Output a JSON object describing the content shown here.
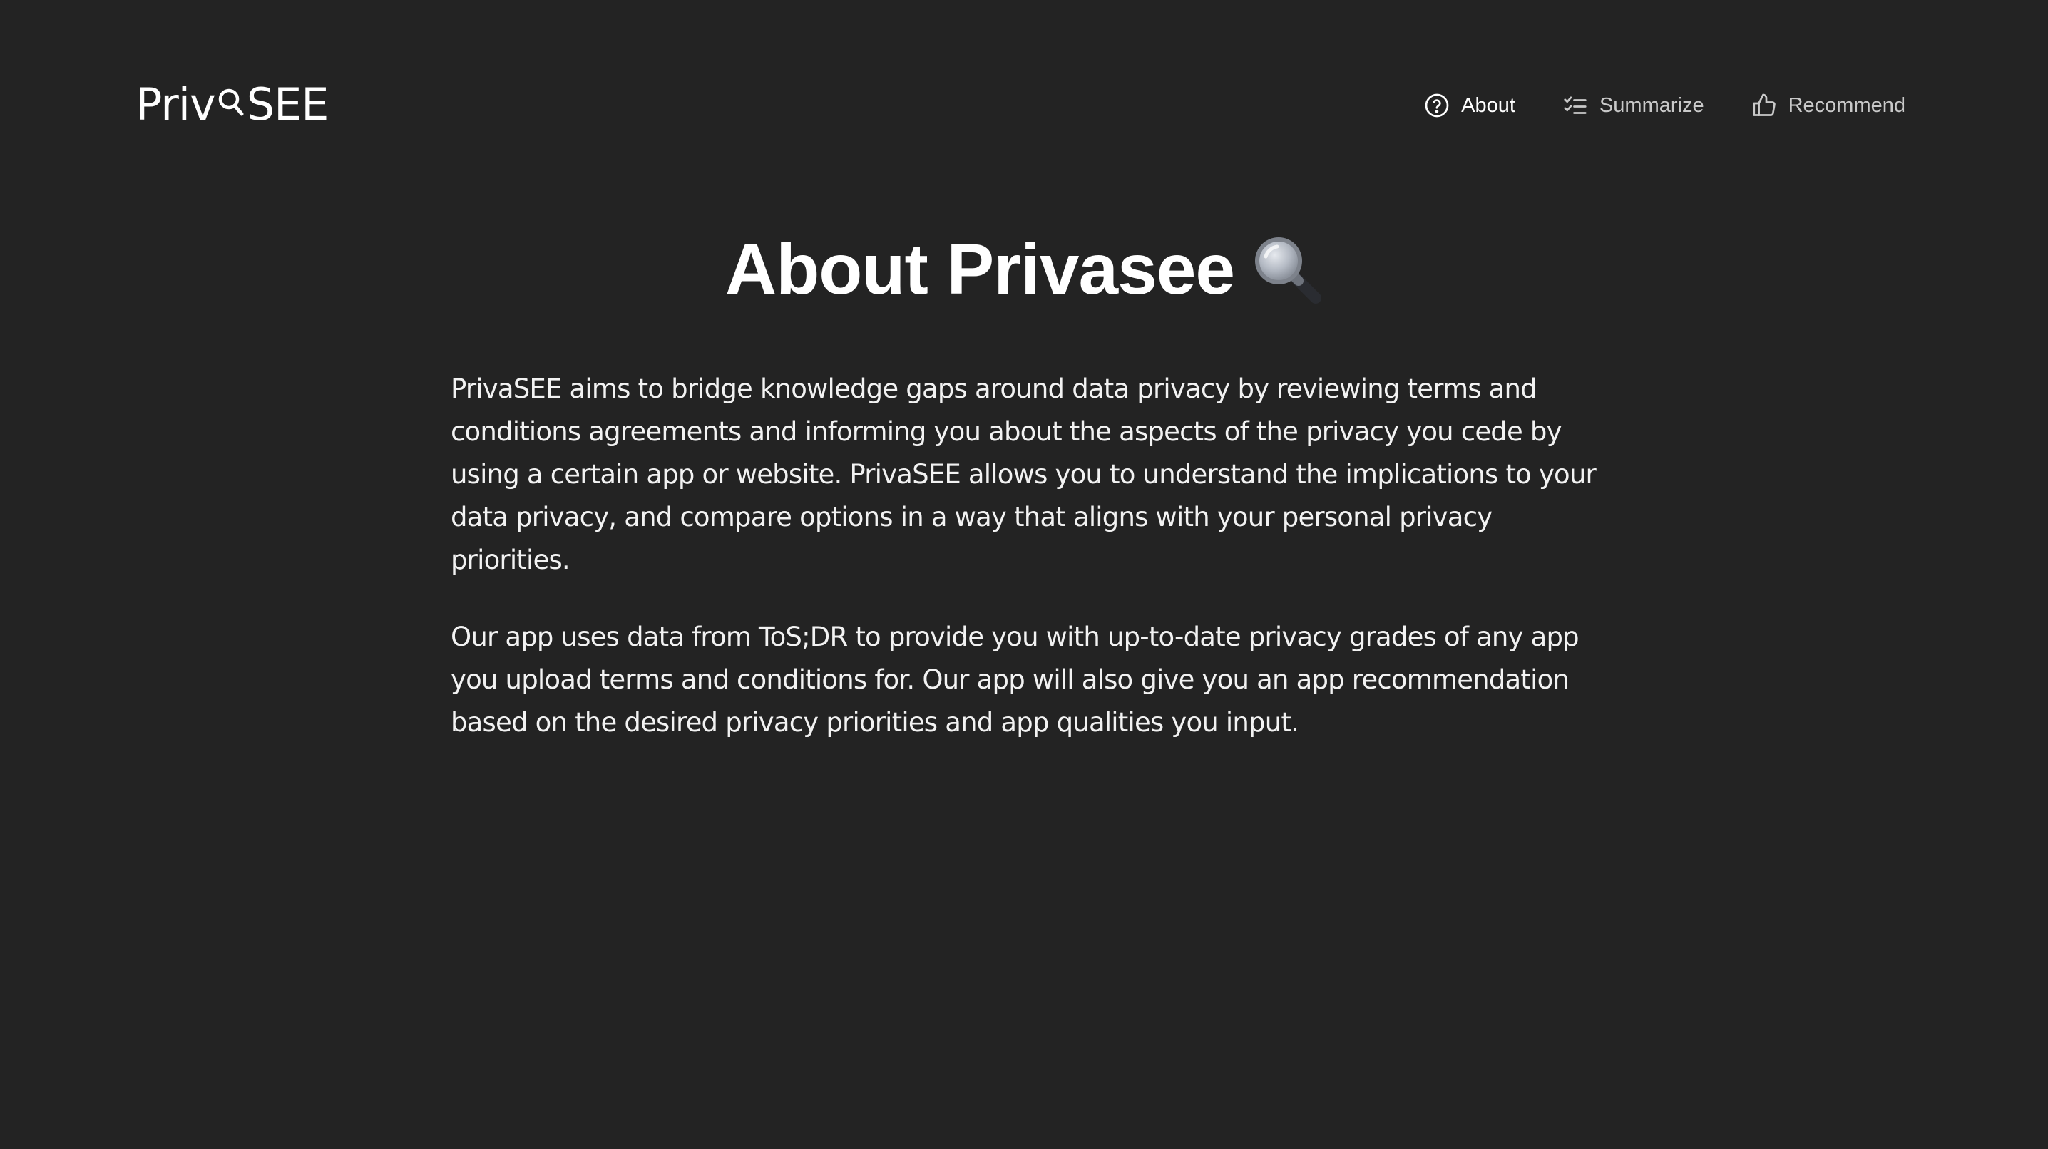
{
  "header": {
    "logo_prefix": "Priv",
    "logo_suffix": "SEE",
    "logo_icon": "magnifier-icon",
    "nav": [
      {
        "label": "About",
        "icon": "question-circle-icon",
        "active": true
      },
      {
        "label": "Summarize",
        "icon": "checklist-icon",
        "active": false
      },
      {
        "label": "Recommend",
        "icon": "thumbs-up-icon",
        "active": false
      }
    ]
  },
  "main": {
    "title": "About Privasee",
    "title_icon": "magnifying-glass-icon",
    "paragraphs": [
      "PrivaSEE aims to bridge knowledge gaps around data privacy by reviewing terms and conditions agreements and informing you about the aspects of the privacy you cede by using a certain app or website. PrivaSEE allows you to understand the implications to your data privacy, and compare options in a way that aligns with your personal privacy priorities.",
      "Our app uses data from ToS;DR to provide you with up-to-date privacy grades of any app you upload terms and conditions for. Our app will also give you an app recommendation based on the desired privacy priorities and app qualities you input."
    ]
  },
  "colors": {
    "background": "#232323",
    "text": "#ffffff",
    "nav_inactive": "#c9c9c9"
  }
}
